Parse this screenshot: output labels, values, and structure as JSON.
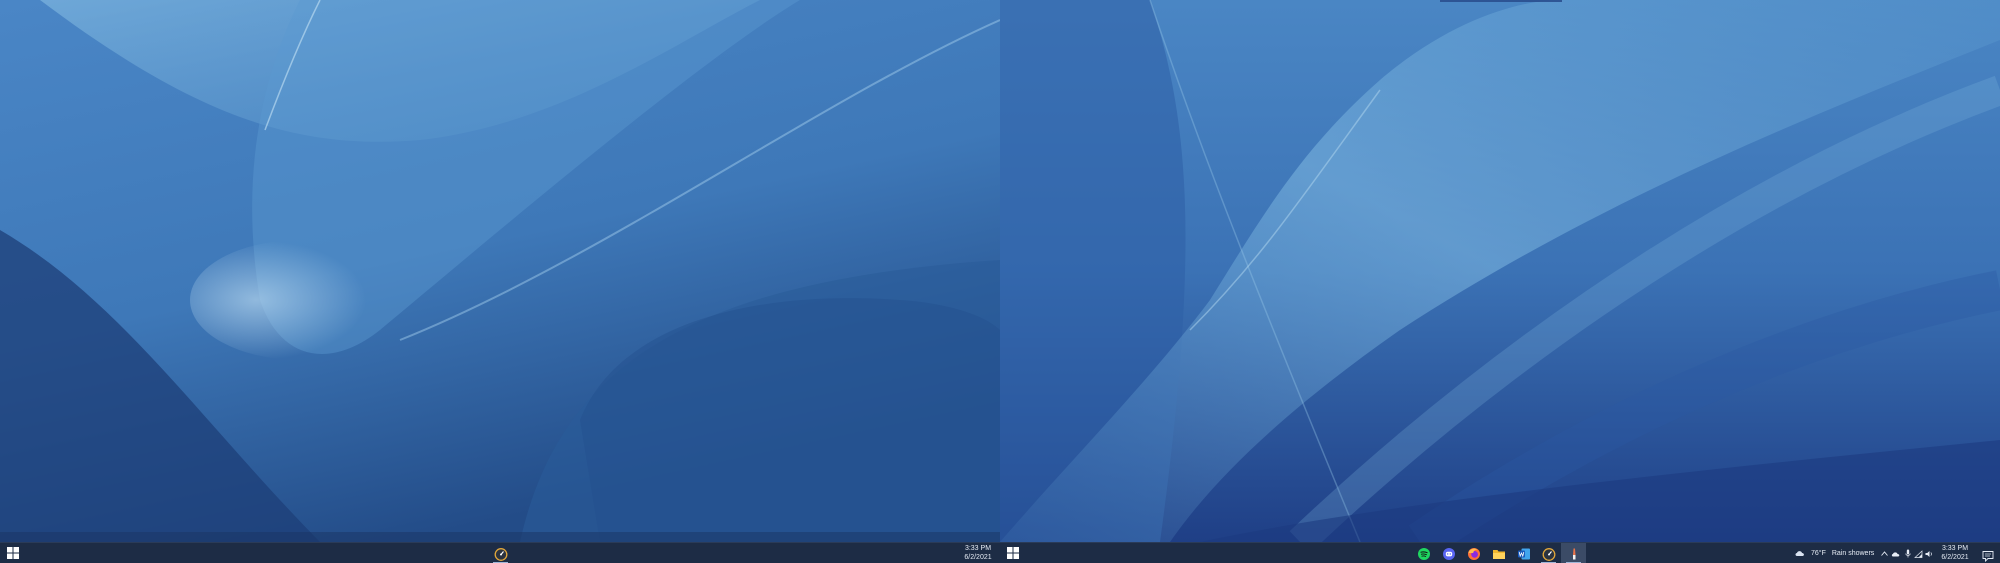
{
  "left_monitor": {
    "taskbar": {
      "start_icon": "windows-logo-icon",
      "apps": [
        {
          "icon": "speedometer-icon",
          "active": false
        }
      ],
      "clock": {
        "time": "3:33 PM",
        "date": "6/2/2021"
      }
    }
  },
  "right_monitor": {
    "taskbar": {
      "start_icon": "windows-logo-icon",
      "apps": [
        {
          "icon": "spotify-icon"
        },
        {
          "icon": "discord-icon"
        },
        {
          "icon": "firefox-icon"
        },
        {
          "icon": "file-explorer-icon"
        },
        {
          "icon": "word-icon"
        },
        {
          "icon": "speedometer-icon"
        },
        {
          "icon": "app-icon",
          "active": true
        }
      ],
      "weather": {
        "icon": "cloud-rain-icon",
        "temperature": "76°F",
        "condition": "Rain showers"
      },
      "tray_icons": [
        "chevron-up-icon",
        "onedrive-cloud-icon",
        "microphone-icon",
        "network-icon",
        "volume-icon"
      ],
      "clock": {
        "time": "3:33 PM",
        "date": "6/2/2021"
      },
      "notification_icon": "notification-icon"
    }
  },
  "colors": {
    "wallpaper_dark": "#1d3f7c",
    "wallpaper_mid": "#3f7dc0",
    "wallpaper_light": "#78b3dd",
    "taskbar": "#1d2c45"
  }
}
